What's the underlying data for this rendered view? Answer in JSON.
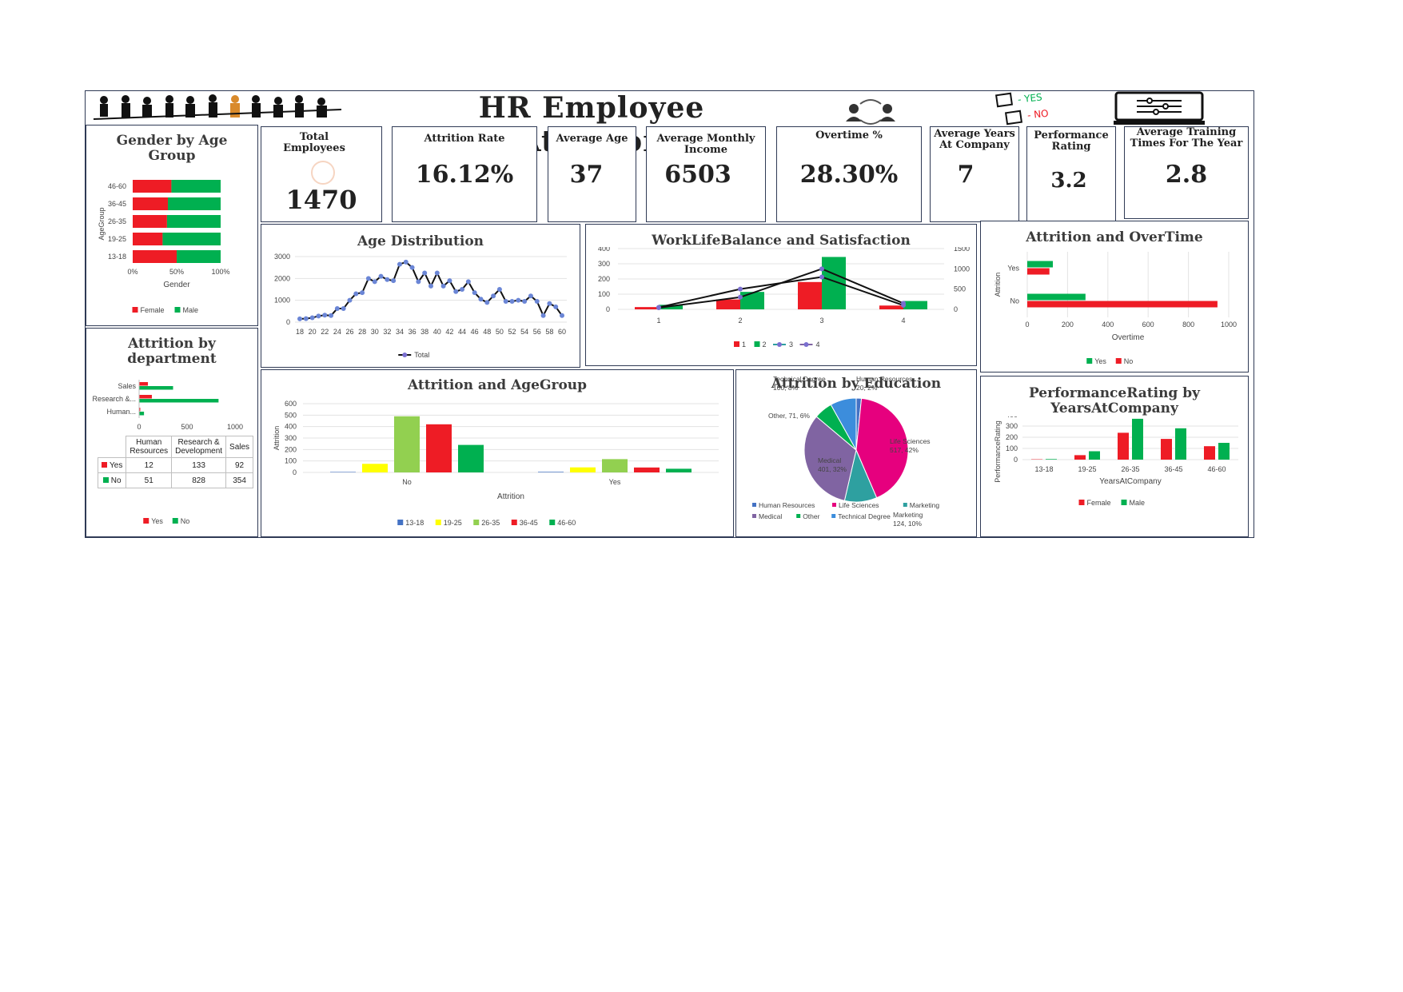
{
  "header": {
    "title": "HR Employee Attrition",
    "check_yes": "- YES",
    "check_no": "- NO"
  },
  "kpis": [
    {
      "label": "Total Employees",
      "value": "1470"
    },
    {
      "label": "Attrition Rate",
      "value": "16.12%"
    },
    {
      "label": "Average Age",
      "value": "37"
    },
    {
      "label": "Average Monthly Income",
      "value": "6503"
    },
    {
      "label": "Overtime %",
      "value": "28.30%"
    },
    {
      "label": "Average Years At Company",
      "value": "7"
    },
    {
      "label": "Performance Rating",
      "value": "3.2"
    },
    {
      "label": "Average Training Times For The Year",
      "value": "2.8"
    }
  ],
  "colors": {
    "red": "#ee1c25",
    "green": "#00b050",
    "blue": "#4472c4",
    "yellow": "#ffff00",
    "lightgreen": "#92d050",
    "purple": "#8064a2",
    "pink": "#e6007e",
    "teal": "#2ea0a0",
    "border": "#2f3a55"
  },
  "chart_data": [
    {
      "id": "gender_age",
      "type": "bar",
      "orientation": "horizontal",
      "stacked": "percent",
      "title": "Gender by Age Group",
      "xlabel": "Gender",
      "ylabel": "AgeGroup",
      "categories": [
        "46-60",
        "36-45",
        "26-35",
        "19-25",
        "13-18"
      ],
      "series": [
        {
          "name": "Female",
          "values": [
            0.44,
            0.4,
            0.39,
            0.34,
            0.5
          ]
        },
        {
          "name": "Male",
          "values": [
            0.56,
            0.6,
            0.61,
            0.66,
            0.5
          ]
        }
      ],
      "xticks": [
        "0%",
        "50%",
        "100%"
      ],
      "legend": "bottom"
    },
    {
      "id": "age_distribution",
      "type": "line",
      "title": "Age Distribution",
      "x": [
        18,
        19,
        20,
        21,
        22,
        23,
        24,
        25,
        26,
        27,
        28,
        29,
        30,
        31,
        32,
        33,
        34,
        35,
        36,
        37,
        38,
        39,
        40,
        41,
        42,
        43,
        44,
        45,
        46,
        47,
        48,
        49,
        50,
        51,
        52,
        53,
        54,
        55,
        56,
        57,
        58,
        59,
        60
      ],
      "series": [
        {
          "name": "Total",
          "values": [
            150,
            160,
            200,
            280,
            320,
            300,
            620,
            620,
            1000,
            1300,
            1350,
            2000,
            1850,
            2100,
            1950,
            1900,
            2650,
            2750,
            2500,
            1850,
            2250,
            1650,
            2250,
            1650,
            1900,
            1400,
            1500,
            1850,
            1350,
            1050,
            900,
            1200,
            1500,
            950,
            950,
            1000,
            950,
            1200,
            950,
            300,
            850,
            700,
            300
          ]
        }
      ],
      "yticks": [
        0,
        1000,
        2000,
        3000
      ],
      "xticks": [
        18,
        20,
        22,
        24,
        26,
        28,
        30,
        32,
        34,
        36,
        38,
        40,
        42,
        44,
        46,
        48,
        50,
        52,
        54,
        56,
        58,
        60
      ],
      "ylim": [
        0,
        3000
      ],
      "legend": "bottom"
    },
    {
      "id": "worklife",
      "type": "bar",
      "title": "WorkLifeBalance and Satisfaction",
      "categories": [
        "1",
        "2",
        "3",
        "4"
      ],
      "series": [
        {
          "name": "1",
          "type": "bar",
          "values": [
            15,
            65,
            180,
            25
          ]
        },
        {
          "name": "2",
          "type": "bar",
          "values": [
            30,
            115,
            345,
            55
          ]
        },
        {
          "name": "3",
          "type": "line",
          "axis": "secondary",
          "values": [
            40,
            300,
            1000,
            150
          ]
        },
        {
          "name": "4",
          "type": "line",
          "axis": "secondary",
          "values": [
            50,
            500,
            800,
            100
          ]
        }
      ],
      "yticks": [
        0,
        100,
        200,
        300,
        400
      ],
      "y2ticks": [
        0,
        500,
        1000,
        1500
      ],
      "ylim": [
        0,
        400
      ],
      "y2lim": [
        0,
        1500
      ],
      "legend": "bottom"
    },
    {
      "id": "attrition_overtime",
      "type": "bar",
      "orientation": "horizontal",
      "title": "Attrition and OverTime",
      "xlabel": "Overtime",
      "ylabel": "Attrition",
      "categories": [
        "Yes",
        "No"
      ],
      "series": [
        {
          "name": "Yes",
          "values": [
            127,
            289
          ]
        },
        {
          "name": "No",
          "values": [
            110,
            944
          ]
        }
      ],
      "xticks": [
        0,
        200,
        400,
        600,
        800,
        1000
      ],
      "xlim": [
        0,
        1000
      ],
      "legend": "bottom"
    },
    {
      "id": "attrition_department",
      "type": "bar",
      "orientation": "horizontal",
      "title": "Attrition by department",
      "categories": [
        "Sales",
        "Research &...",
        "Human..."
      ],
      "series": [
        {
          "name": "Yes",
          "values": [
            92,
            133,
            12
          ]
        },
        {
          "name": "No",
          "values": [
            354,
            828,
            51
          ]
        }
      ],
      "xticks": [
        0,
        500,
        1000
      ],
      "xlim": [
        0,
        1000
      ],
      "legend": "bottom",
      "table": {
        "headers": [
          "Human Resources",
          "Research & Development",
          "Sales"
        ],
        "rows": [
          {
            "label": "Yes",
            "values": [
              "12",
              "133",
              "92"
            ]
          },
          {
            "label": "No",
            "values": [
              "51",
              "828",
              "354"
            ]
          }
        ]
      }
    },
    {
      "id": "attrition_agegroup",
      "type": "bar",
      "title": "Attrition and AgeGroup",
      "xlabel": "Attrition",
      "ylabel": "Attrition",
      "categories": [
        "No",
        "Yes"
      ],
      "series": [
        {
          "name": "13-18",
          "values": [
            4,
            5
          ]
        },
        {
          "name": "19-25",
          "values": [
            75,
            44
          ]
        },
        {
          "name": "26-35",
          "values": [
            490,
            116
          ]
        },
        {
          "name": "36-45",
          "values": [
            420,
            43
          ]
        },
        {
          "name": "46-60",
          "values": [
            240,
            32
          ]
        }
      ],
      "yticks": [
        0,
        100,
        200,
        300,
        400,
        500,
        600
      ],
      "ylim": [
        0,
        600
      ],
      "legend": "bottom"
    },
    {
      "id": "attrition_education",
      "type": "pie",
      "title": "Attrition by Education",
      "slices": [
        {
          "name": "Human Resources",
          "value": 20,
          "pct": "2%"
        },
        {
          "name": "Life Sciences",
          "value": 517,
          "pct": "42%"
        },
        {
          "name": "Marketing",
          "value": 124,
          "pct": "10%"
        },
        {
          "name": "Medical",
          "value": 401,
          "pct": "32%"
        },
        {
          "name": "Other",
          "value": 71,
          "pct": "6%"
        },
        {
          "name": "Technical Degree",
          "value": 100,
          "pct": "8%"
        }
      ],
      "labels": [
        {
          "text": "Technical Degree, 100, 8%"
        },
        {
          "text": "Human Resources, 20, 2%"
        },
        {
          "text": "Other, 71, 6%"
        },
        {
          "text": "Life Sciences, 517, 42%"
        },
        {
          "text": "Medical, 401, 32%"
        },
        {
          "text": "Marketing, 124, 10%"
        }
      ],
      "legend": "bottom"
    },
    {
      "id": "performance_years",
      "type": "bar",
      "title": "PerformanceRating by YearsAtCompany",
      "xlabel": "YearsAtCompany",
      "ylabel": "PerformanceRating",
      "categories": [
        "13-18",
        "19-25",
        "26-35",
        "36-45",
        "46-60"
      ],
      "series": [
        {
          "name": "Female",
          "values": [
            3,
            40,
            240,
            185,
            120
          ]
        },
        {
          "name": "Male",
          "values": [
            5,
            75,
            365,
            280,
            150
          ]
        }
      ],
      "yticks": [
        0,
        100,
        200,
        300,
        400
      ],
      "ylim": [
        0,
        400
      ],
      "legend": "bottom"
    }
  ]
}
